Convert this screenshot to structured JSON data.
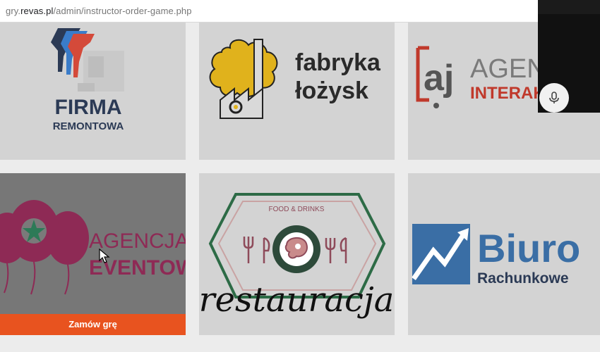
{
  "browser": {
    "url_prefix": "gry.",
    "url_host": "revas.pl",
    "url_path": "/admin/instructor-order-game.php"
  },
  "cards": [
    {
      "id": "firma-remontowa",
      "line1": "FIRMA",
      "line2": "REMONTOWA"
    },
    {
      "id": "fabryka-lozysk",
      "line1": "fabryka",
      "line2": "łożysk"
    },
    {
      "id": "agencja-interaktywna",
      "badge": "aj",
      "line1": "AGEN",
      "line2": "INTERAK"
    },
    {
      "id": "agencja-eventowa",
      "line1": "AGENCJA",
      "line2": "EVENTOWA",
      "order_button": "Zamów grę"
    },
    {
      "id": "restauracja",
      "tagline": "FOOD & DRINKS",
      "script": "restauracja"
    },
    {
      "id": "biuro-rachunkowe",
      "line1": "Biuro",
      "line2": "Rachunkowe"
    }
  ],
  "colors": {
    "accent": "#e8531f",
    "navy": "#2b3a55",
    "interak_red": "#c0392b",
    "eventowa_magenta": "#8e2a55",
    "biuro_blue": "#3a6ea5"
  },
  "icons": {
    "mic": "microphone-icon",
    "cursor": "cursor-pointer-icon"
  }
}
